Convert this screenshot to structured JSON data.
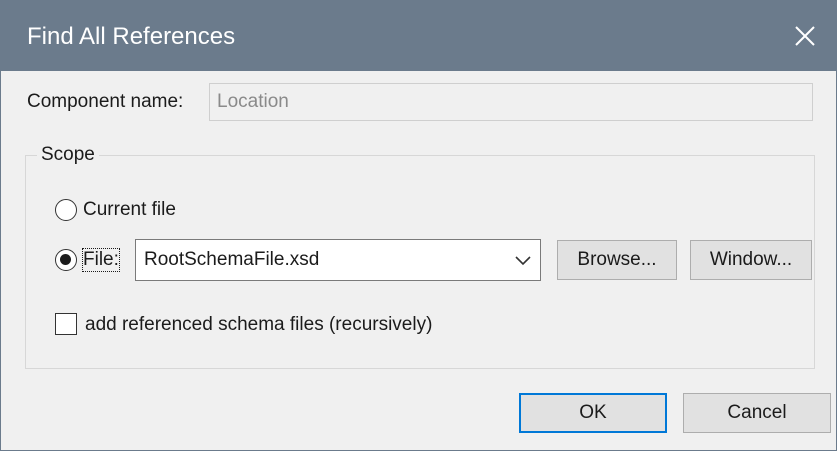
{
  "dialog": {
    "title": "Find All References",
    "close_glyph": "✕"
  },
  "component": {
    "label": "Component name:",
    "value": "Location"
  },
  "scope": {
    "legend": "Scope",
    "current_file_label": "Current file",
    "file_label": "File:",
    "selected": "File:",
    "file_value": "RootSchemaFile.xsd",
    "browse_label": "Browse...",
    "window_label": "Window...",
    "recursive_label": "add referenced schema files (recursively)",
    "recursive_checked": false
  },
  "footer": {
    "ok_label": "OK",
    "cancel_label": "Cancel"
  },
  "colors": {
    "titlebar": "#6b7b8c",
    "dialog_bg": "#f0f0f0",
    "default_button_border": "#0078d7"
  }
}
